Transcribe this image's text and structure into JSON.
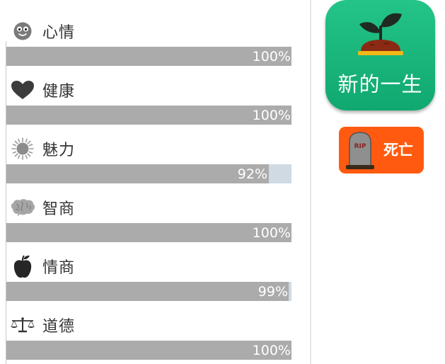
{
  "stats": [
    {
      "name": "心情",
      "icon": "smiley-face-icon",
      "value": 100,
      "percent_text": "100%"
    },
    {
      "name": "健康",
      "icon": "heart-icon",
      "value": 100,
      "percent_text": "100%"
    },
    {
      "name": "魅力",
      "icon": "sun-icon",
      "value": 92,
      "percent_text": "92%"
    },
    {
      "name": "智商",
      "icon": "brain-icon",
      "value": 100,
      "percent_text": "100%"
    },
    {
      "name": "情商",
      "icon": "apple-icon",
      "value": 99,
      "percent_text": "99%"
    },
    {
      "name": "道德",
      "icon": "balance-scale-icon",
      "value": 100,
      "percent_text": "100%"
    }
  ],
  "actions": {
    "rebirth_label": "新的一生",
    "rebirth_icon": "sprout-icon",
    "death_label": "死亡",
    "death_icon": "tombstone-icon",
    "tombstone_text": "RIP"
  },
  "colors": {
    "bar_fill": "#ababab",
    "bar_track": "#cfdae3",
    "rebirth_button": "#17b57b",
    "death_button": "#ff5a0f"
  }
}
